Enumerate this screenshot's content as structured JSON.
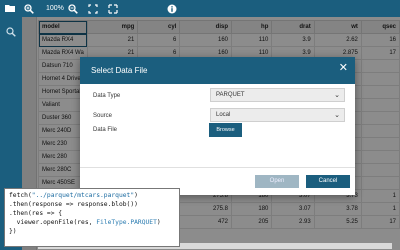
{
  "toolbar": {
    "buttons": [
      "folder-open-icon",
      "zoom-in-icon",
      "zoom-out-icon",
      "fit-screen-icon",
      "fullscreen-icon",
      "info-icon"
    ],
    "zoom": "100%"
  },
  "grid": {
    "columns": [
      "model",
      "mpg",
      "cyl",
      "disp",
      "hp",
      "drat",
      "wt",
      "qsec"
    ],
    "rows": [
      [
        "Mazda RX4",
        "21",
        "6",
        "160",
        "110",
        "3.9",
        "2.62",
        "16"
      ],
      [
        "Mazda RX4 Wa",
        "21",
        "6",
        "160",
        "110",
        "3.9",
        "2.875",
        "17"
      ],
      [
        "Datsun 710",
        "",
        "",
        "",
        "",
        "",
        "",
        ""
      ],
      [
        "Hornet 4 Drive",
        "",
        "",
        "",
        "",
        "",
        "",
        ""
      ],
      [
        "Hornet Sportab",
        "",
        "",
        "",
        "",
        "",
        "",
        ""
      ],
      [
        "Valiant",
        "",
        "",
        "",
        "",
        "",
        "",
        ""
      ],
      [
        "Duster 360",
        "",
        "",
        "",
        "",
        "",
        "",
        ""
      ],
      [
        "Merc 240D",
        "",
        "",
        "",
        "",
        "",
        "",
        ""
      ],
      [
        "Merc 230",
        "",
        "",
        "",
        "",
        "",
        "",
        ""
      ],
      [
        "Merc 280",
        "",
        "",
        "",
        "",
        "",
        "",
        ""
      ],
      [
        "Merc 280C",
        "",
        "",
        "",
        "",
        "",
        "",
        ""
      ],
      [
        "Merc 450SE",
        "",
        "",
        "",
        "",
        "",
        "",
        ""
      ],
      [
        "",
        "",
        "",
        "275.8",
        "180",
        "3.07",
        "3.73",
        "1"
      ],
      [
        "",
        "",
        "",
        "275.8",
        "180",
        "3.07",
        "3.78",
        "1"
      ],
      [
        "",
        "",
        "",
        "472",
        "205",
        "2.93",
        "5.25",
        "17"
      ]
    ]
  },
  "dialog": {
    "title": "Select Data File",
    "data_type_label": "Data Type",
    "data_type_value": "PARQUET",
    "source_label": "Source",
    "source_value": "Local",
    "data_file_label": "Data File",
    "browse_label": "Browse",
    "open_label": "Open",
    "cancel_label": "Cancel"
  },
  "code": {
    "line1_a": "fetch(",
    "line1_str": "\"../parquet/mtcars.parquet\"",
    "line1_b": ")",
    "line2": ".then(response => response.blob())",
    "line3": ".then(res => {",
    "line4_a": "  viewer.openFile(res, ",
    "line4_kw": "FileType.PARQUET",
    "line4_b": ")",
    "line5": "})"
  },
  "colors": {
    "accent": "#1b5e7e",
    "disabled": "#9fb6c3"
  }
}
